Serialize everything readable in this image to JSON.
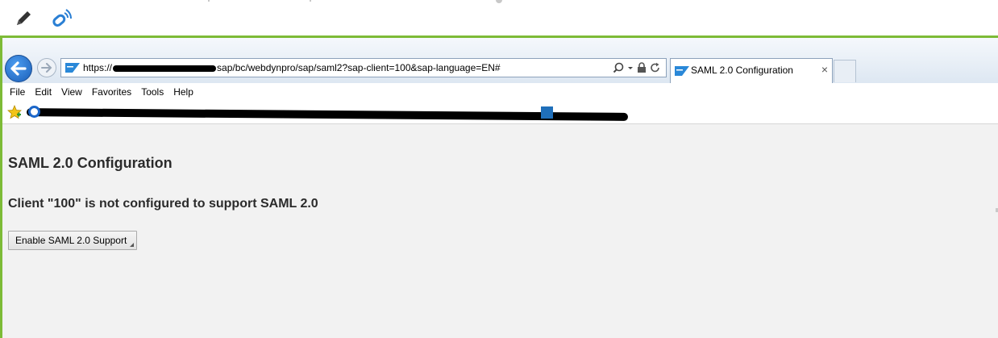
{
  "browser": {
    "url_prefix": "https://",
    "url_suffix": "sap/bc/webdynpro/sap/saml2?sap-client=100&sap-language=EN#",
    "tab_title": "SAML 2.0 Configuration",
    "tab_close": "×"
  },
  "menu": {
    "items": [
      "File",
      "Edit",
      "View",
      "Favorites",
      "Tools",
      "Help"
    ]
  },
  "page": {
    "title": "SAML 2.0 Configuration",
    "message": "Client \"100\" is not configured to support SAML 2.0",
    "enable_button": "Enable SAML 2.0 Support"
  },
  "colors": {
    "frame_border": "#7dbb37",
    "back_button": "#1b5fb8",
    "content_bg": "#f2f2f2"
  },
  "icons": {
    "toolbar": [
      "pencil-icon",
      "link-icon"
    ],
    "address": [
      "search-icon",
      "dropdown-icon",
      "lock-icon",
      "refresh-icon"
    ]
  }
}
